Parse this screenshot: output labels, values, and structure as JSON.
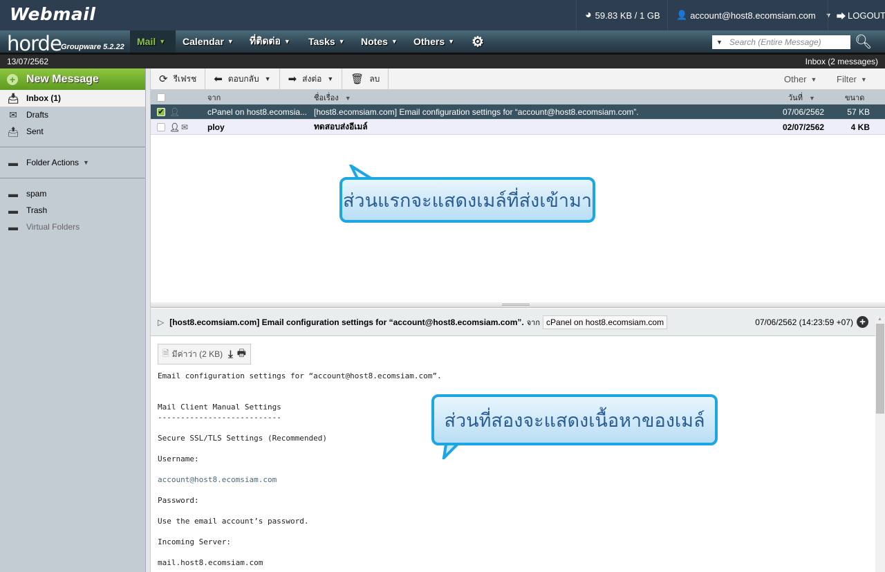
{
  "topbar": {
    "logo": "Webmail",
    "quota": "59.83 KB / 1 GB",
    "account": "account@host8.ecomsiam.com",
    "logout": "LOGOUT"
  },
  "nav": {
    "brand": "horde",
    "version": "Groupware 5.2.22",
    "items": [
      {
        "label": "Mail",
        "active": true
      },
      {
        "label": "Calendar"
      },
      {
        "label": "ที่ติดต่อ"
      },
      {
        "label": "Tasks"
      },
      {
        "label": "Notes"
      },
      {
        "label": "Others"
      }
    ],
    "search_placeholder": "Search (Entire Message)"
  },
  "status": {
    "date": "13/07/2562",
    "folder_info": "Inbox (2 messages)"
  },
  "sidebar": {
    "new_message": "New Message",
    "folders": [
      {
        "label": "Inbox (1)",
        "icon": "inbox-icon",
        "selected": true
      },
      {
        "label": "Drafts",
        "icon": "drafts-icon"
      },
      {
        "label": "Sent",
        "icon": "sent-icon"
      }
    ],
    "folder_actions": "Folder Actions",
    "other_folders": [
      {
        "label": "spam",
        "icon": "folder-icon"
      },
      {
        "label": "Trash",
        "icon": "folder-icon"
      },
      {
        "label": "Virtual Folders",
        "icon": "virtual-folder-icon"
      }
    ]
  },
  "toolbar": {
    "refresh": "รีเฟรช",
    "reply": "ตอบกลับ",
    "forward": "ส่งต่อ",
    "delete": "ลบ",
    "other": "Other",
    "filter": "Filter"
  },
  "list": {
    "columns": {
      "from": "จาก",
      "subject": "ชื่อเรื่อง",
      "date": "วันที่",
      "size": "ขนาด"
    },
    "rows": [
      {
        "from": "cPanel on host8.ecomsia...",
        "subject": "[host8.ecomsiam.com] Email configuration settings for “account@host8.ecomsiam.com”.",
        "date": "07/06/2562",
        "size": "57 KB",
        "selected": true,
        "checked": true
      },
      {
        "from": "ploy",
        "subject": "ทดสอบส่งอีเมล์",
        "date": "02/07/2562",
        "size": "4 KB",
        "unseen": true,
        "checked": false
      }
    ]
  },
  "preview": {
    "subject": "[host8.ecomsiam.com] Email configuration settings for “account@host8.ecomsiam.com”.",
    "from_label": "จาก",
    "from": "cPanel on host8.ecomsiam.com",
    "datetime": "07/06/2562 (14:23:59 +07)",
    "attachment": "มีค่าว่า (2 KB)",
    "body": [
      "Email configuration settings for “account@host8.ecomsiam.com”.",
      "",
      "",
      "Mail Client Manual Settings",
      "---------------------------",
      "",
      "Secure SSL/TLS Settings (Recommended)",
      "",
      "Username:",
      "",
      "account@host8.ecomsiam.com",
      "",
      "Password:",
      "",
      "Use the email account’s password.",
      "",
      "Incoming Server:",
      "",
      "mail.host8.ecomsiam.com"
    ]
  },
  "annotations": {
    "first": "ส่วนแรกจะแสดงเมล์ที่ส่งเข้ามา",
    "second": "ส่วนที่สองจะแสดงเนื้อหาของเมล์"
  },
  "colors": {
    "topbar": "#2c3e50",
    "accent_green": "#8cc63f",
    "selected_row": "#38525f",
    "callout_border": "#1ca7e3"
  }
}
